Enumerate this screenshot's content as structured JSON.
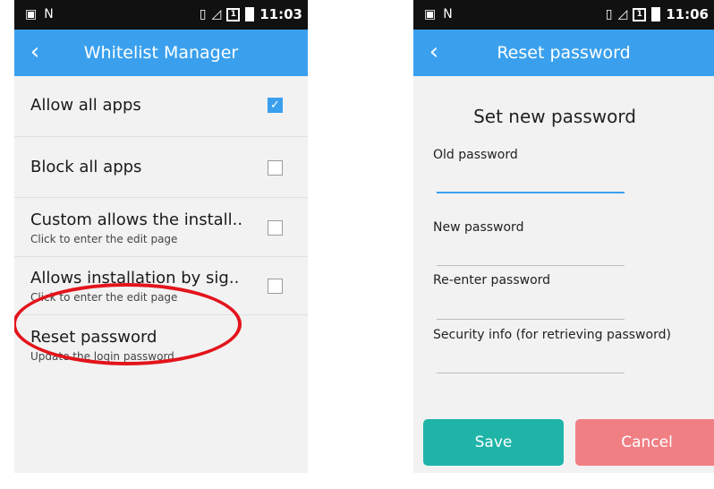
{
  "status_bar": {
    "left_time": "11:03",
    "right_time": "11:06",
    "n_letter": "N",
    "box_glyph": "1"
  },
  "left_screen": {
    "title": "Whitelist Manager",
    "items": [
      {
        "label": "Allow all apps",
        "checked": true
      },
      {
        "label": "Block all apps",
        "checked": false
      },
      {
        "label": "Custom allows the install..",
        "subtitle": "Click to enter the edit page",
        "checked": false
      },
      {
        "label": "Allows installation by sig..",
        "subtitle": "Click to enter the edit page",
        "checked": false
      },
      {
        "label": "Reset password",
        "subtitle": "Update the login password"
      }
    ],
    "highlight_color": "#e3141b"
  },
  "right_screen": {
    "title": "Reset password",
    "heading": "Set new password",
    "fields": {
      "old_password": {
        "label": "Old password",
        "value": ""
      },
      "new_password": {
        "label": "New password",
        "value": ""
      },
      "reenter_password": {
        "label": "Re-enter password",
        "value": ""
      },
      "security_info": {
        "label": "Security info (for retrieving password)",
        "value": ""
      }
    },
    "save_label": "Save",
    "cancel_label": "Cancel"
  },
  "colors": {
    "appbar": "#3aa0ee",
    "save": "#1fb4a8",
    "cancel": "#f07f84"
  },
  "icons": [
    "back-arrow-icon",
    "vibrate-icon",
    "signal-icon",
    "sim-icon",
    "battery-icon",
    "notification-n-icon",
    "sd-icon",
    "checkmark-icon"
  ]
}
